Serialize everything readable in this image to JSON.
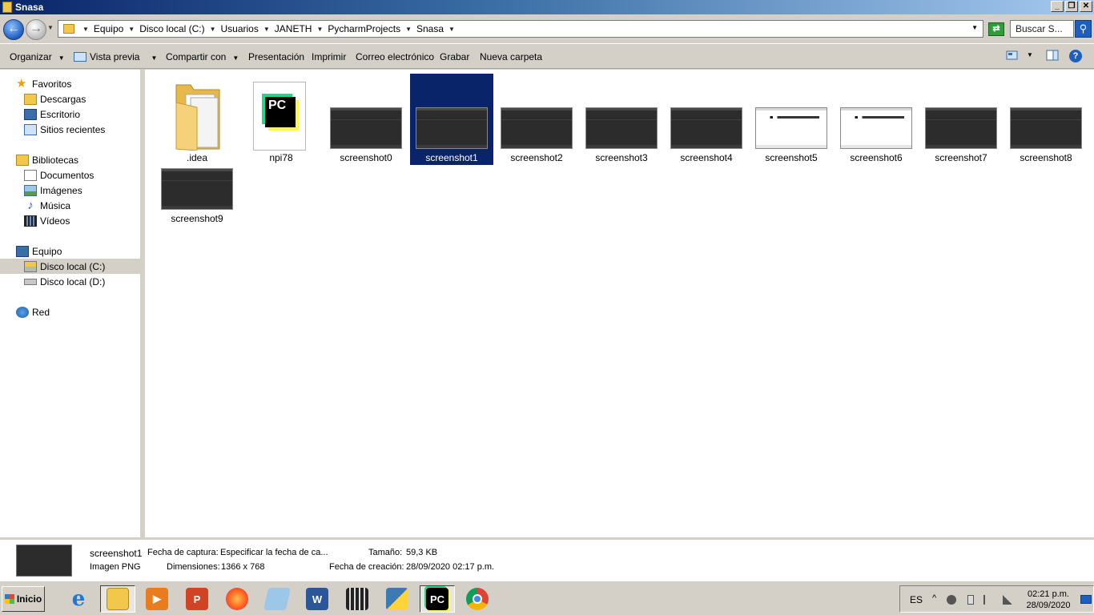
{
  "window": {
    "title": "Snasa"
  },
  "titlebar_buttons": {
    "minimize": "_",
    "restore": "❐",
    "close": "✕"
  },
  "address": {
    "crumbs": [
      "Equipo",
      "Disco local (C:)",
      "Usuarios",
      "JANETH",
      "PycharmProjects",
      "Snasa"
    ],
    "search_placeholder": "Buscar S..."
  },
  "toolbar": {
    "organize": "Organizar",
    "preview": "Vista previa",
    "share": "Compartir con",
    "presentation": "Presentación",
    "print": "Imprimir",
    "email": "Correo electrónico",
    "burn": "Grabar",
    "new_folder": "Nueva carpeta",
    "help": "?"
  },
  "nav": {
    "favorites": {
      "label": "Favoritos",
      "items": [
        "Descargas",
        "Escritorio",
        "Sitios recientes"
      ]
    },
    "libraries": {
      "label": "Bibliotecas",
      "items": [
        "Documentos",
        "Imágenes",
        "Música",
        "Vídeos"
      ]
    },
    "computer": {
      "label": "Equipo",
      "items": [
        "Disco local (C:)",
        "Disco local (D:)"
      ],
      "selected": "Disco local (C:)"
    },
    "network": {
      "label": "Red"
    }
  },
  "files": [
    {
      "name": ".idea",
      "type": "folder"
    },
    {
      "name": "npi78",
      "type": "pycharm"
    },
    {
      "name": "screenshot0",
      "type": "dark"
    },
    {
      "name": "screenshot1",
      "type": "dark",
      "selected": true
    },
    {
      "name": "screenshot2",
      "type": "dark"
    },
    {
      "name": "screenshot3",
      "type": "dark"
    },
    {
      "name": "screenshot4",
      "type": "dark"
    },
    {
      "name": "screenshot5",
      "type": "light"
    },
    {
      "name": "screenshot6",
      "type": "light"
    },
    {
      "name": "screenshot7",
      "type": "dark"
    },
    {
      "name": "screenshot8",
      "type": "dark"
    },
    {
      "name": "screenshot9",
      "type": "dark"
    }
  ],
  "details": {
    "name": "screenshot1",
    "type": "Imagen PNG",
    "capture_label": "Fecha de captura:",
    "capture_value": "Especificar la fecha de ca...",
    "dimensions_label": "Dimensiones:",
    "dimensions_value": "1366 x 768",
    "size_label": "Tamaño:",
    "size_value": "59,3 KB",
    "created_label": "Fecha de creación:",
    "created_value": "28/09/2020 02:17 p.m."
  },
  "taskbar": {
    "start": "Inicio",
    "apps": [
      {
        "icon": "internet-explorer-icon",
        "glyph": "e",
        "color": "#1e78d7"
      },
      {
        "icon": "file-explorer-icon",
        "glyph": "",
        "color": "#f1c84b",
        "active": true
      },
      {
        "icon": "media-player-icon",
        "glyph": "▶",
        "color": "#e87c1e"
      },
      {
        "icon": "powerpoint-icon",
        "glyph": "P",
        "color": "#d04423"
      },
      {
        "icon": "firefox-icon",
        "glyph": "",
        "color": "#ff7b1c"
      },
      {
        "icon": "notepad-icon",
        "glyph": "",
        "color": "#9cc7e8"
      },
      {
        "icon": "word-icon",
        "glyph": "W",
        "color": "#2b579a"
      },
      {
        "icon": "terminal-app-icon",
        "glyph": "",
        "color": "#222222"
      },
      {
        "icon": "python-icon",
        "glyph": "",
        "color": "#3d7ab3"
      },
      {
        "icon": "pycharm-icon",
        "glyph": "PC",
        "color": "#000000",
        "active": true
      },
      {
        "icon": "chrome-icon",
        "glyph": "",
        "color": "#dd4b39"
      }
    ],
    "lang": "ES",
    "time": "02:21 p.m.",
    "date": "28/09/2020"
  },
  "colors": {
    "selection": "#0a246a",
    "chrome": "#d4d0c8",
    "title_start": "#0a246a"
  }
}
